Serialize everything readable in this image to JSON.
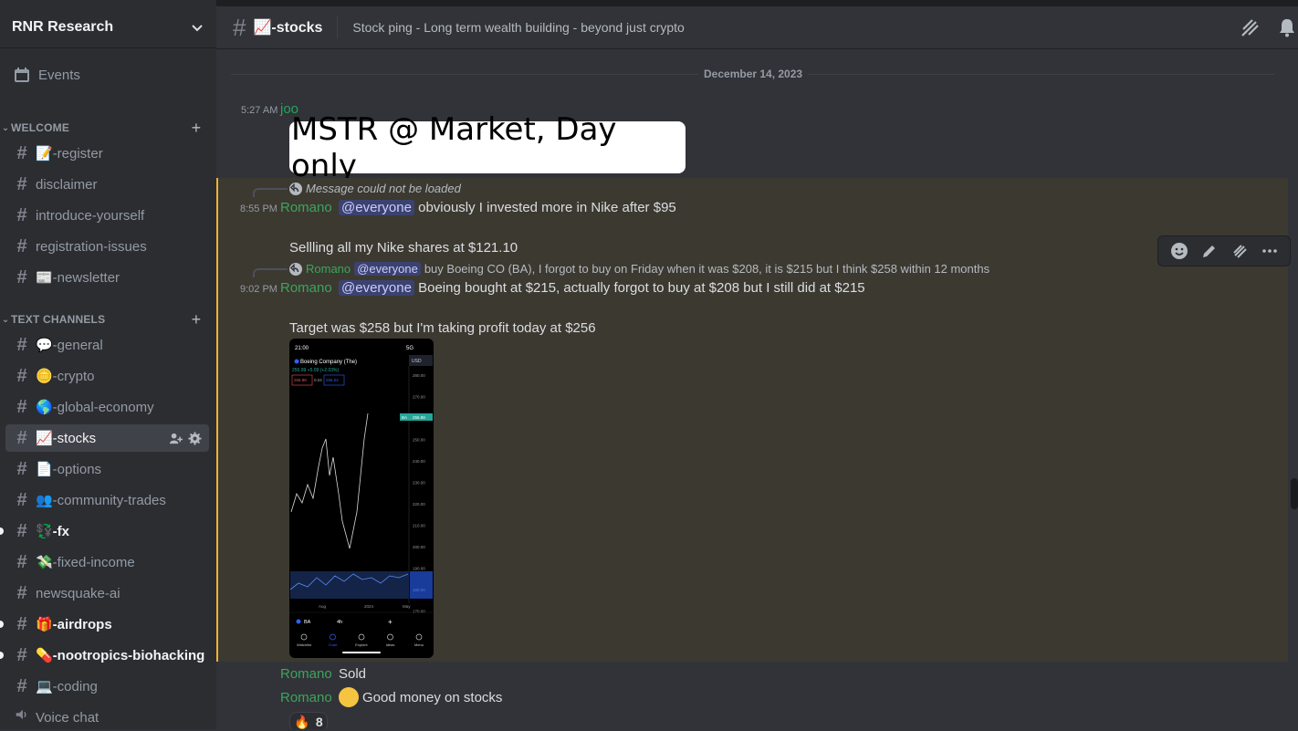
{
  "server": {
    "name": "RNR Research"
  },
  "sidebar": {
    "events_label": "Events",
    "categories": {
      "welcome": "WELCOME",
      "text_channels": "TEXT CHANNELS"
    },
    "welcome_channels": [
      {
        "label": "📝-register"
      },
      {
        "label": "disclaimer"
      },
      {
        "label": "introduce-yourself"
      },
      {
        "label": "registration-issues"
      },
      {
        "label": "📰-newsletter"
      }
    ],
    "text_channels": [
      {
        "label": "💬-general"
      },
      {
        "label": "🪙-crypto"
      },
      {
        "label": "🌎-global-economy"
      },
      {
        "label": "📈-stocks"
      },
      {
        "label": "📄-options"
      },
      {
        "label": "👥-community-trades"
      },
      {
        "label": "💱-fx"
      },
      {
        "label": "💸-fixed-income"
      },
      {
        "label": "newsquake-ai"
      },
      {
        "label": "🎁-airdrops"
      },
      {
        "label": "💊-nootropics-biohacking"
      },
      {
        "label": "💻-coding"
      },
      {
        "label": "Voice chat"
      }
    ]
  },
  "header": {
    "channel": "📈-stocks",
    "topic": "Stock ping - Long term wealth building - beyond just crypto"
  },
  "messages": {
    "date": "December 14, 2023",
    "m1": {
      "time": "5:27 AM",
      "author": "joo",
      "card_text": "MSTR @ Market, Day only"
    },
    "m2": {
      "reply_text": "Message could not be loaded",
      "time": "8:55 PM",
      "author": "Romano",
      "mention": "@everyone",
      "line1": "obviously I invested more in Nike after $95",
      "line2": "Sellling all my Nike shares at $121.10"
    },
    "m3": {
      "reply_author": "Romano",
      "reply_mention": "@everyone",
      "reply_text": "buy Boeing CO (BA), I forgot to buy on Friday when it was $208, it is $215 but I think $258 within 12 months",
      "time": "9:02 PM",
      "author": "Romano",
      "mention": "@everyone",
      "line1": "Boeing bought at $215, actually forgot to buy at $208 but I still did at $215",
      "line2": "Target was $258 but I'm taking profit today at $256"
    },
    "m4": {
      "author": "Romano",
      "text": "Sold"
    },
    "m5": {
      "author": "Romano",
      "text": "Good money on stocks",
      "reaction_emoji": "🔥",
      "reaction_count": "8"
    }
  },
  "phone_chart": {
    "status_time": "21:00",
    "status_right": "5G",
    "title": "Boeing Company (The)",
    "price_line": "255.99 +5.09 (+2.03%)",
    "bid": "255.98",
    "spread": "0.04",
    "ask": "256.02",
    "currency": "USD",
    "y_ticks": [
      "280.00",
      "270.00",
      "260.00",
      "250.00",
      "240.00",
      "230.00",
      "220.00",
      "210.00",
      "200.00",
      "190.00",
      "180.00",
      "170.00"
    ],
    "price_tag_symbol": "BA",
    "price_tag_value": "255.99",
    "x_ticks": [
      "Aug",
      "2024",
      "May"
    ],
    "symbol": "BA",
    "interval": "4h",
    "nav": [
      "Watchlist",
      "Chart",
      "Explore",
      "Ideas",
      "Menu"
    ]
  },
  "colors": {
    "accent_green": "#23a55a",
    "author_green": "#3ba55c",
    "highlight_bar": "#f0b232",
    "mention_bg": "#3c4270"
  }
}
